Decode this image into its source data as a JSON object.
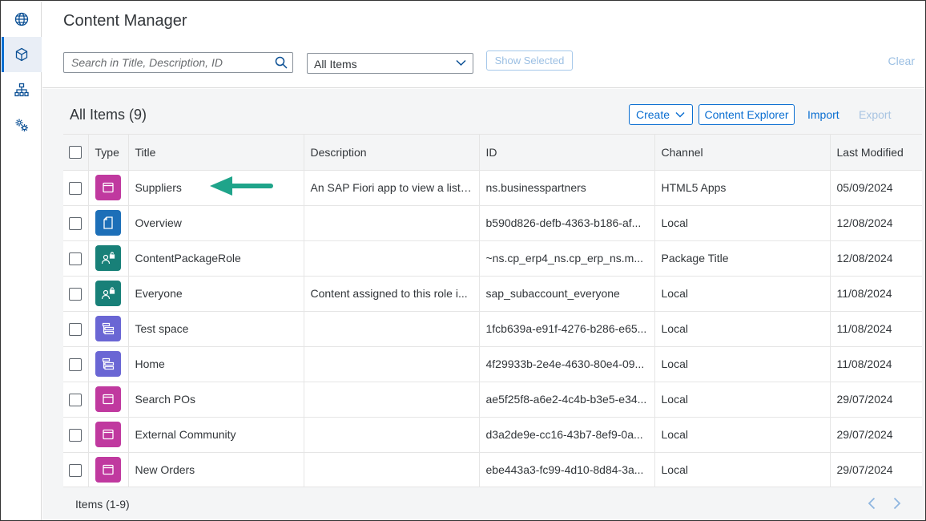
{
  "app": {
    "title": "Content Manager"
  },
  "sidebar": {
    "items": [
      {
        "icon": "globe-icon",
        "active": false
      },
      {
        "icon": "cube-icon",
        "active": true
      },
      {
        "icon": "sitemap-icon",
        "active": false
      },
      {
        "icon": "gears-icon",
        "active": false
      }
    ]
  },
  "filter": {
    "search_placeholder": "Search in Title, Description, ID",
    "select_value": "All Items",
    "show_selected_label": "Show Selected",
    "clear_label": "Clear"
  },
  "table": {
    "title": "All Items (9)",
    "toolbar": {
      "create_label": "Create",
      "explorer_label": "Content Explorer",
      "import_label": "Import",
      "export_label": "Export"
    },
    "columns": [
      "Type",
      "Title",
      "Description",
      "ID",
      "Channel",
      "Last Modified"
    ],
    "rows": [
      {
        "type": "app",
        "title": "Suppliers",
        "description": "An SAP Fiori app to view a list ...",
        "id": "ns.businesspartners",
        "channel": "HTML5 Apps",
        "modified": "05/09/2024"
      },
      {
        "type": "page",
        "title": "Overview",
        "description": "",
        "id": "b590d826-defb-4363-b186-af...",
        "channel": "Local",
        "modified": "12/08/2024"
      },
      {
        "type": "role",
        "title": "ContentPackageRole",
        "description": "",
        "id": "~ns.cp_erp4_ns.cp_erp_ns.m...",
        "channel": "Package Title",
        "modified": "12/08/2024"
      },
      {
        "type": "role",
        "title": "Everyone",
        "description": "Content assigned to this role i...",
        "id": "sap_subaccount_everyone",
        "channel": "Local",
        "modified": "11/08/2024"
      },
      {
        "type": "space",
        "title": "Test space",
        "description": "",
        "id": "1fcb639a-e91f-4276-b286-e65...",
        "channel": "Local",
        "modified": "11/08/2024"
      },
      {
        "type": "space",
        "title": "Home",
        "description": "",
        "id": "4f29933b-2e4e-4630-80e4-09...",
        "channel": "Local",
        "modified": "11/08/2024"
      },
      {
        "type": "app",
        "title": "Search POs",
        "description": "",
        "id": "ae5f25f8-a6e2-4c4b-b3e5-e34...",
        "channel": "Local",
        "modified": "29/07/2024"
      },
      {
        "type": "app",
        "title": "External Community",
        "description": "",
        "id": "d3a2de9e-cc16-43b7-8ef9-0a...",
        "channel": "Local",
        "modified": "29/07/2024"
      },
      {
        "type": "app",
        "title": "New Orders",
        "description": "",
        "id": "ebe443a3-fc99-4d10-8d84-3a...",
        "channel": "Local",
        "modified": "29/07/2024"
      }
    ],
    "footer_label": "Items (1-9)"
  },
  "colors": {
    "app": "#c0399f",
    "page": "#1d6fb8",
    "role": "#188078",
    "space": "#6a66d4",
    "accent": "#0a6ed1",
    "annotation_arrow": "#1fa48a"
  }
}
